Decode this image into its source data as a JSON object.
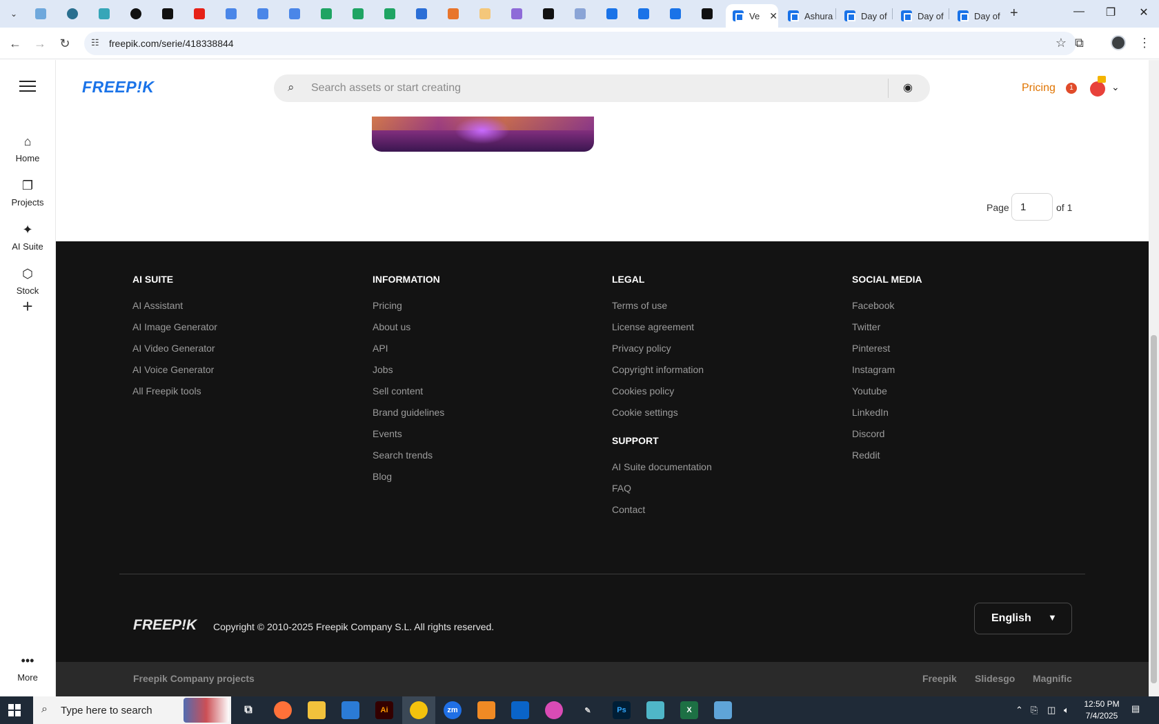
{
  "browser": {
    "tabs": [
      {
        "label": "Ve",
        "active": true
      },
      {
        "label": "Ashura",
        "active": false
      },
      {
        "label": "Day of",
        "active": false
      },
      {
        "label": "Day of",
        "active": false
      },
      {
        "label": "Day of",
        "active": false
      }
    ],
    "url": "freepik.com/serie/418338844"
  },
  "sidebar": {
    "items": [
      {
        "label": "Home",
        "icon": "home-icon"
      },
      {
        "label": "Projects",
        "icon": "projects-icon"
      },
      {
        "label": "AI Suite",
        "icon": "sparkle-icon"
      },
      {
        "label": "Stock",
        "icon": "stock-icon"
      }
    ],
    "more_label": "More"
  },
  "header": {
    "logo": "FREEP!K",
    "search_placeholder": "Search assets or start creating",
    "pricing_label": "Pricing",
    "notification_count": "1"
  },
  "pagination": {
    "page_label": "Page",
    "current_page": "1",
    "of_label": "of 1"
  },
  "footer": {
    "columns": [
      {
        "heading": "AI SUITE",
        "links": [
          "AI Assistant",
          "AI Image Generator",
          "AI Video Generator",
          "AI Voice Generator",
          "All Freepik tools"
        ]
      },
      {
        "heading": "INFORMATION",
        "links": [
          "Pricing",
          "About us",
          "API",
          "Jobs",
          "Sell content",
          "Brand guidelines",
          "Events",
          "Search trends",
          "Blog"
        ]
      },
      {
        "heading": "LEGAL",
        "links": [
          "Terms of use",
          "License agreement",
          "Privacy policy",
          "Copyright information",
          "Cookies policy",
          "Cookie settings"
        ]
      },
      {
        "heading": "SOCIAL MEDIA",
        "links": [
          "Facebook",
          "Twitter",
          "Pinterest",
          "Instagram",
          "Youtube",
          "LinkedIn",
          "Discord",
          "Reddit"
        ]
      }
    ],
    "support": {
      "heading": "SUPPORT",
      "links": [
        "AI Suite documentation",
        "FAQ",
        "Contact"
      ]
    },
    "logo": "FREEP!K",
    "copyright": "Copyright © 2010-2025 Freepik Company S.L. All rights reserved.",
    "language": "English",
    "company_projects_label": "Freepik Company projects",
    "projects": [
      "Freepik",
      "Slidesgo",
      "Magnific"
    ]
  },
  "taskbar": {
    "search_text": "Type here to search",
    "time": "12:50 PM",
    "date": "7/4/2025"
  },
  "colors": {
    "brand": "#1a73e8",
    "pricing": "#e07400",
    "footer_bg": "#131313"
  }
}
